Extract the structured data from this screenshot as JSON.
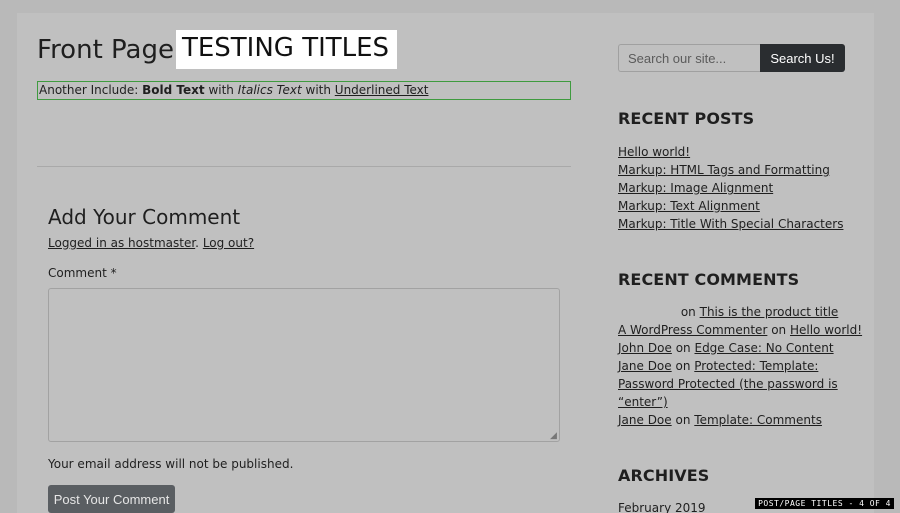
{
  "post": {
    "title_plain": "Front Page",
    "title_highlight": "TESTING TITLES",
    "include": {
      "prefix": "Another Include: ",
      "bold": "Bold Text",
      "sep1": " with ",
      "italic": "Italics Text",
      "sep2": " with ",
      "underline": "Underlined Text"
    }
  },
  "comment_form": {
    "heading": "Add Your Comment",
    "logged_in_text": "Logged in as hostmaster",
    "separator": ". ",
    "logout_text": "Log out?",
    "comment_label": "Comment *",
    "comment_value": "",
    "notice": "Your email address will not be published.",
    "submit_label": "Post Your Comment"
  },
  "sidebar": {
    "search": {
      "placeholder": "Search our site...",
      "button_label": "Search Us!"
    },
    "recent_posts": {
      "title": "RECENT POSTS",
      "items": [
        "Hello world!",
        "Markup: HTML Tags and Formatting",
        "Markup: Image Alignment",
        "Markup: Text Alignment",
        "Markup: Title With Special Characters"
      ]
    },
    "recent_comments": {
      "title": "RECENT COMMENTS",
      "items": [
        {
          "author": "",
          "on": "on",
          "post": "This is the product title"
        },
        {
          "author": "A WordPress Commenter",
          "on": "on",
          "post": "Hello world!"
        },
        {
          "author": "John Doe",
          "on": "on",
          "post": "Edge Case: No Content"
        },
        {
          "author": "Jane Doe",
          "on": "on",
          "post": "Protected: Template: Password Protected (the password is “enter”)"
        },
        {
          "author": "Jane Doe",
          "on": "on",
          "post": "Template: Comments"
        }
      ]
    },
    "archives": {
      "title": "ARCHIVES",
      "items": [
        "February 2019"
      ]
    }
  },
  "overlay": {
    "caption": "POST/PAGE TITLES - 4 OF 4"
  }
}
